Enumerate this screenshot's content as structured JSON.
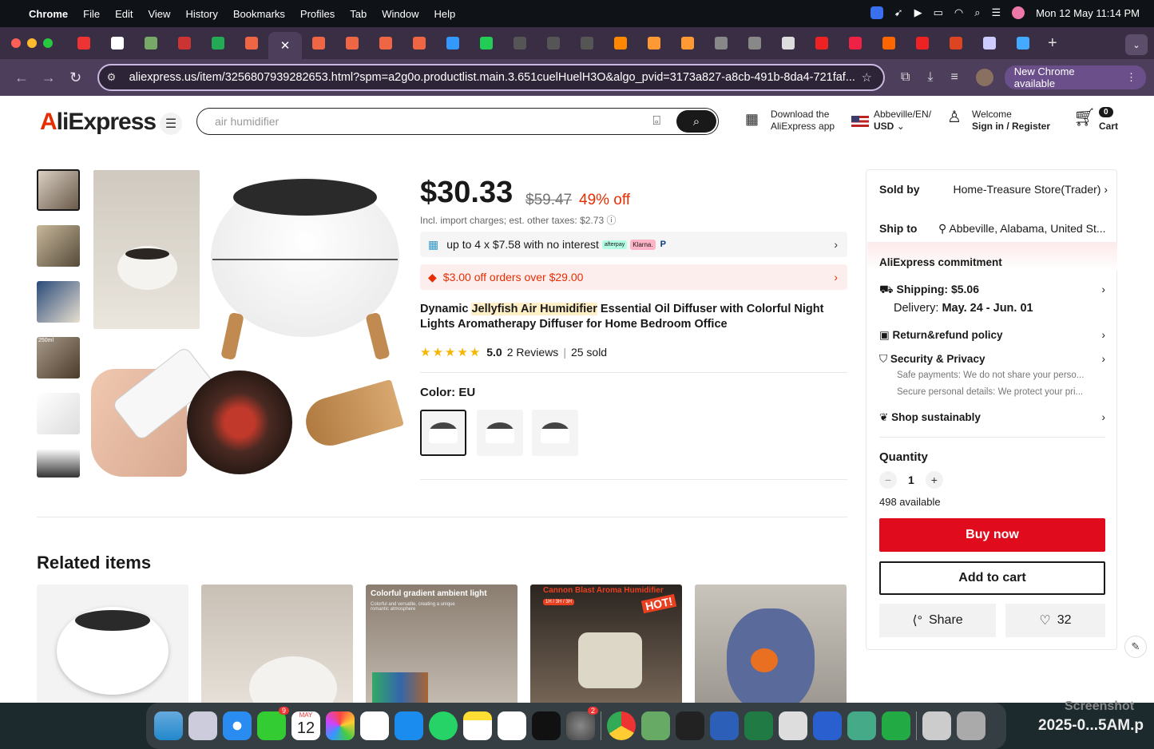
{
  "menubar": {
    "app": "Chrome",
    "items": [
      "File",
      "Edit",
      "View",
      "History",
      "Bookmarks",
      "Profiles",
      "Tab",
      "Window",
      "Help"
    ],
    "clock": "Mon 12 May  11:14 PM"
  },
  "browser": {
    "url": "aliexpress.us/item/3256807939282653.html?spm=a2g0o.productlist.main.3.651cuelHuelH3O&algo_pvid=3173a827-a8cb-491b-8da4-721faf...",
    "new_chrome_label": "New Chrome available",
    "tab_favicon_colors": [
      "#e33",
      "#fff",
      "#7a6",
      "#c33",
      "#2a5",
      "#e64",
      "#e64",
      "#e64",
      "#e64",
      "#e64",
      "#e64",
      "#39f",
      "#2c5",
      "#555",
      "#555",
      "#555",
      "#f80",
      "#f93",
      "#f93",
      "#888",
      "#888",
      "#ddd",
      "#e22",
      "#e24",
      "#f60",
      "#e22",
      "#d42",
      "#ccf",
      "#4af"
    ]
  },
  "header": {
    "logo_a": "A",
    "logo_rest": "liExpress",
    "search_placeholder": "air humidifier",
    "download_line1": "Download the",
    "download_line2": "AliExpress app",
    "locale_line1": "Abbeville/EN/",
    "locale_line2": "USD",
    "welcome": "Welcome",
    "signin": "Sign in / Register",
    "cart_count": "0",
    "cart_label": "Cart"
  },
  "product": {
    "price": "$30.33",
    "old_price": "$59.47",
    "discount": "49% off",
    "tax_note": "Incl. import charges; est. other taxes: $2.73 ⓘ",
    "installments": "up to 4 x $7.58 with no interest",
    "pay_badges": [
      "afterpay",
      "Klarna.",
      "P"
    ],
    "coupon": "$3.00 off orders over $29.00",
    "title_prefix": "Dynamic ",
    "title_highlight": "Jellyfish Air Humidifier",
    "title_suffix": " Essential Oil Diffuser with Colorful Night Lights Aromatherapy Diffuser for Home Bedroom Office",
    "rating": "5.0",
    "reviews": "2 Reviews",
    "sold": "25 sold",
    "color_label": "Color: EU",
    "thumb_label": "250ml"
  },
  "panel": {
    "sold_by_label": "Sold by",
    "sold_by_value": "Home-Treasure Store(Trader)",
    "ship_to_label": "Ship to",
    "ship_to_value": "Abbeville, Alabama, United St...",
    "commitment": "AliExpress commitment",
    "shipping": "Shipping: $5.06",
    "delivery_prefix": "Delivery: ",
    "delivery_dates": "May. 24 - Jun. 01",
    "return_policy": "Return&refund policy",
    "security": "Security & Privacy",
    "security_note1": "Safe payments: We do not share your perso...",
    "security_note2": "Secure personal details: We protect your pri...",
    "sustain": "Shop sustainably",
    "quantity_label": "Quantity",
    "quantity_value": "1",
    "available": "498 available",
    "buy_now": "Buy now",
    "add_to_cart": "Add to cart",
    "share": "Share",
    "wishlist_count": "32"
  },
  "related": {
    "heading": "Related items",
    "card3_caption": "Colorful gradient ambient light",
    "card3_sub": "Colorful and versatile, creating a unique romantic atmosphere",
    "card4_caption": "Cannon Blast Aroma Humidifier",
    "card4_badge": "HOT!",
    "card4_sub": "1H / 3H / 3H"
  },
  "dock": {
    "messages_badge": "9",
    "calendar_month": "MAY",
    "calendar_day": "12",
    "settings_badge": "2",
    "screenshot_label": "Screenshot",
    "screenshot_file": "2025-0...5AM.p"
  }
}
